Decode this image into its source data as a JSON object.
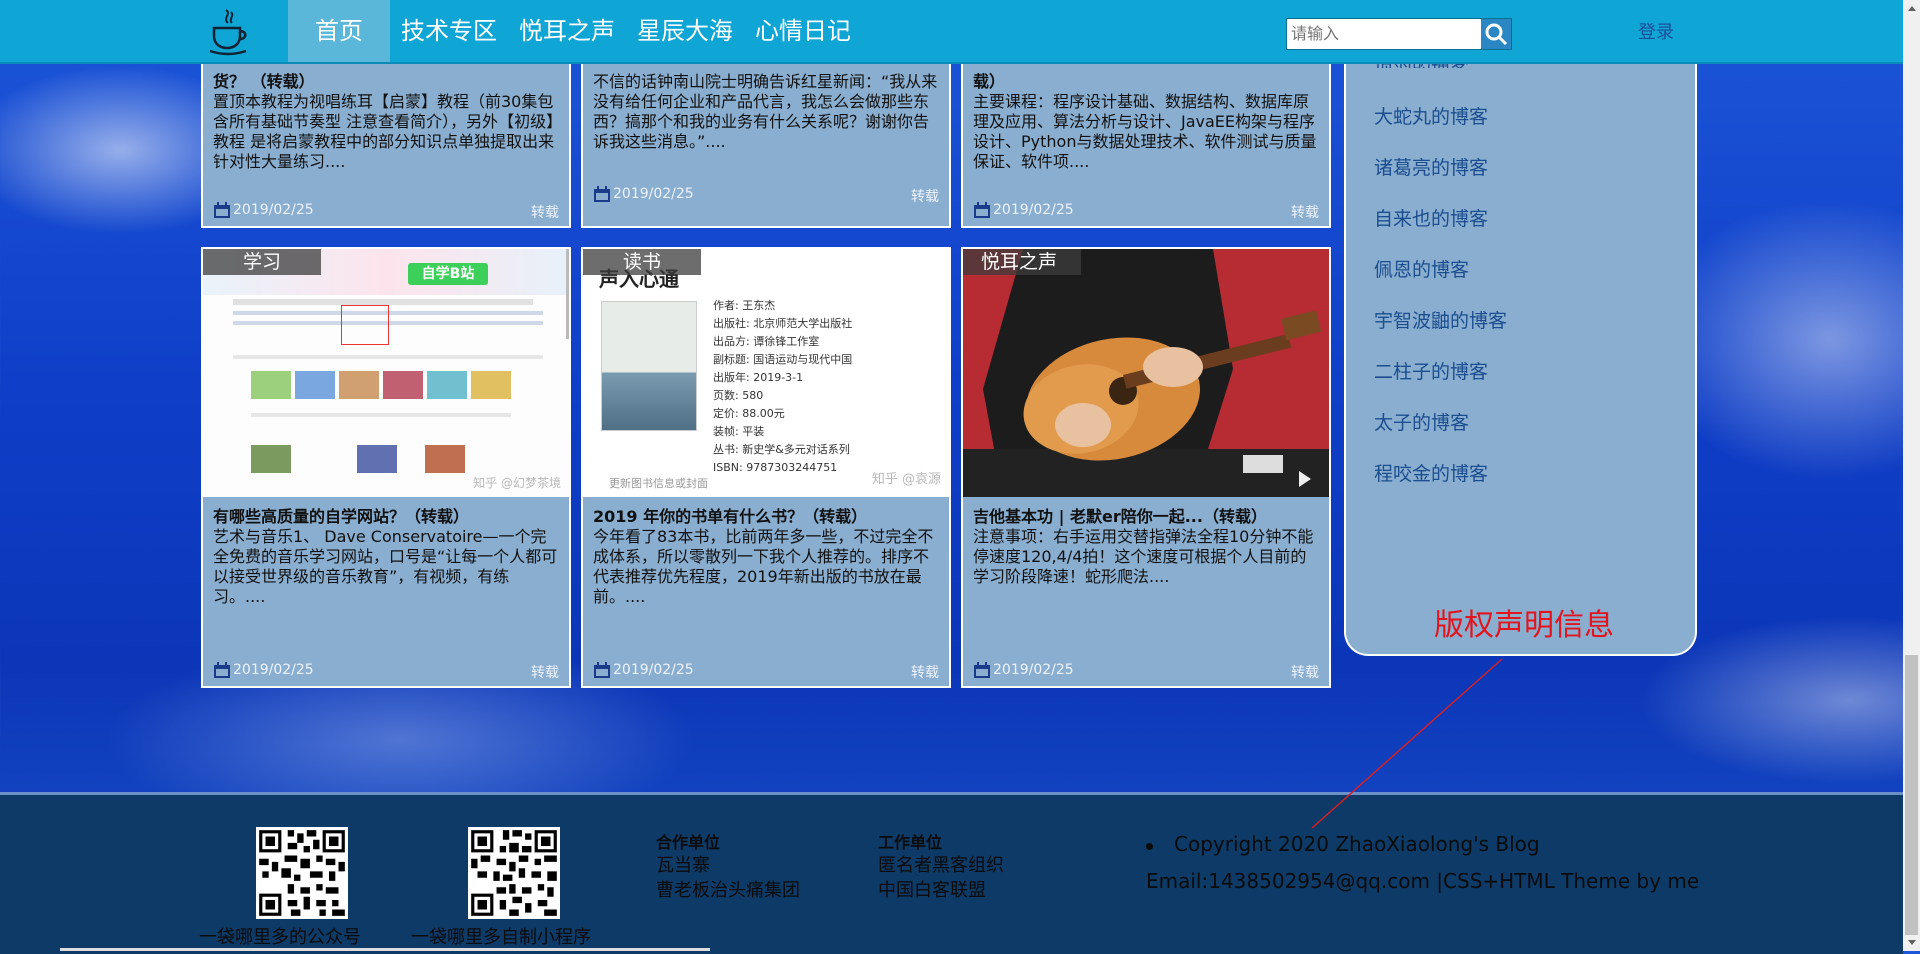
{
  "nav": {
    "items": [
      "首页",
      "技术专区",
      "悦耳之声",
      "星辰大海",
      "心情日记"
    ],
    "active_index": 0
  },
  "search": {
    "placeholder": "请输入"
  },
  "login": "登录",
  "cards": [
    {
      "category": "",
      "title": "货？ （转载）",
      "desc": "置顶本教程为视唱练耳【启蒙】教程（前30集包含所有基础节奏型 注意查看简介），另外【初级】教程 是将启蒙教程中的部分知识点单独提取出来针对性大量练习....",
      "date": "2019/02/25",
      "tag": "转载"
    },
    {
      "category": "",
      "title": "",
      "desc": "不信的话钟南山院士明确告诉红星新闻：“我从来没有给任何企业和产品代言，我怎么会做那些东西？搞那个和我的业务有什么关系呢？谢谢你告诉我这些消息。”....",
      "date": "2019/02/25",
      "tag": "转载"
    },
    {
      "category": "",
      "title": "载）",
      "desc": "主要课程：程序设计基础、数据结构、数据库原理及应用、算法分析与设计、JavaEE构架与程序设计、Python与数据处理技术、软件测试与质量保证、软件项....",
      "date": "2019/02/25",
      "tag": "转载"
    },
    {
      "category": "学习",
      "title": "有哪些高质量的自学网站？（转载）",
      "desc": "艺术与音乐1、 Dave Conservatoire—一个完全免费的音乐学习网站，口号是“让每一个人都可以接受世界级的音乐教育”，有视频，有练习。....",
      "date": "2019/02/25",
      "tag": "转载"
    },
    {
      "category": "读书",
      "title": "2019 年你的书单有什么书？（转载）",
      "desc": "今年看了83本书，比前两年多一些，不过完全不成体系，所以零散列一下我个人推荐的。排序不代表推荐优先程度，2019年新出版的书放在最前。....",
      "date": "2019/02/25",
      "tag": "转载"
    },
    {
      "category": "悦耳之声",
      "title": "吉他基本功 | 老默er陪你一起...（转载）",
      "desc": "注意事项：右手运用交替指弹法全程10分钟不能停速度120,4/4拍！这个速度可根据个人目前的学习阶段降速！蛇形爬法....",
      "date": "2019/02/25",
      "tag": "转载"
    }
  ],
  "book_shot": {
    "book_title": "声入心通",
    "lines": [
      "作者: 王东杰",
      "出版社: 北京师范大学出版社",
      "出品方: 谭徐锋工作室",
      "副标题: 国语运动与现代中国",
      "出版年: 2019-3-1",
      "页数: 580",
      "定价: 88.00元",
      "装帧: 平装",
      "丛书: 新史学&多元对话系列",
      "ISBN: 9787303244751"
    ],
    "cover_caption": "更新图书信息或封面",
    "watermark": "知乎 @袁源"
  },
  "site_shot": {
    "watermark": "知乎 @幻梦茶境",
    "banner": "自学B站"
  },
  "sidebar": {
    "top_partial": "项羽的博客",
    "items": [
      "大蛇丸的博客",
      "诸葛亮的博客",
      "自来也的博客",
      "佩恩的博客",
      "宇智波鼬的博客",
      "二柱子的博客",
      "太子的博客",
      "程咬金的博客"
    ]
  },
  "copyright_note": "版权声明信息",
  "footer": {
    "qr1_label": "一袋哪里多的公众号",
    "qr2_label": "一袋哪里多自制小程序",
    "coop_title": "合作单位",
    "coop_items": [
      "瓦当寨",
      "曹老板治头痛集团"
    ],
    "work_title": "工作单位",
    "work_items": [
      "匿名者黑客组织",
      "中国白客联盟"
    ],
    "copyright": "Copyright 2020 ZhaoXiaolong's Blog",
    "email_line": "Email:1438502954@qq.com |CSS+HTML Theme by me"
  },
  "colors": {
    "header": "#0fa6d6",
    "card": "#8aaed0",
    "footer": "#0d3a66",
    "note": "#e4141c"
  }
}
